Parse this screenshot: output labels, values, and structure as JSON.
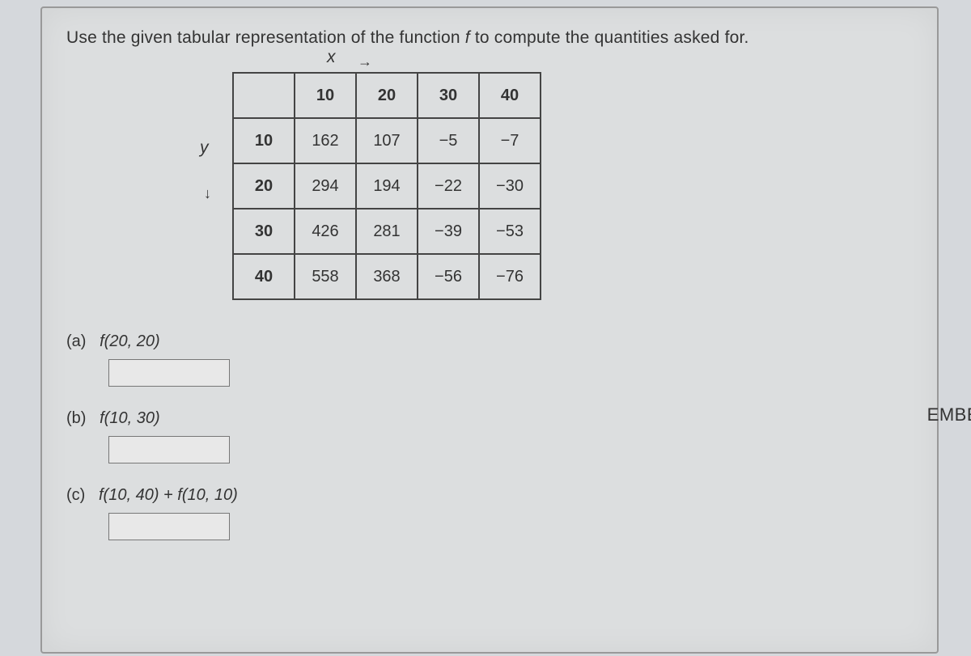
{
  "instruction_prefix": "Use the given tabular representation of the function ",
  "instruction_f": "f",
  "instruction_suffix": " to compute the quantities asked for.",
  "axis_x": "x",
  "axis_y": "y",
  "arrow_right": "→",
  "arrow_down": "↓",
  "table": {
    "col_headers": [
      "10",
      "20",
      "30",
      "40"
    ],
    "row_headers": [
      "10",
      "20",
      "30",
      "40"
    ],
    "rows": [
      [
        "162",
        "107",
        "−5",
        "−7"
      ],
      [
        "294",
        "194",
        "−22",
        "−30"
      ],
      [
        "426",
        "281",
        "−39",
        "−53"
      ],
      [
        "558",
        "368",
        "−56",
        "−76"
      ]
    ]
  },
  "questions": {
    "a": {
      "marker": "(a)",
      "text": "f(20, 20)"
    },
    "b": {
      "marker": "(b)",
      "text": "f(10, 30)"
    },
    "c": {
      "marker": "(c)",
      "text": "f(10, 40) + f(10, 10)"
    }
  },
  "side_text": "EMBE"
}
